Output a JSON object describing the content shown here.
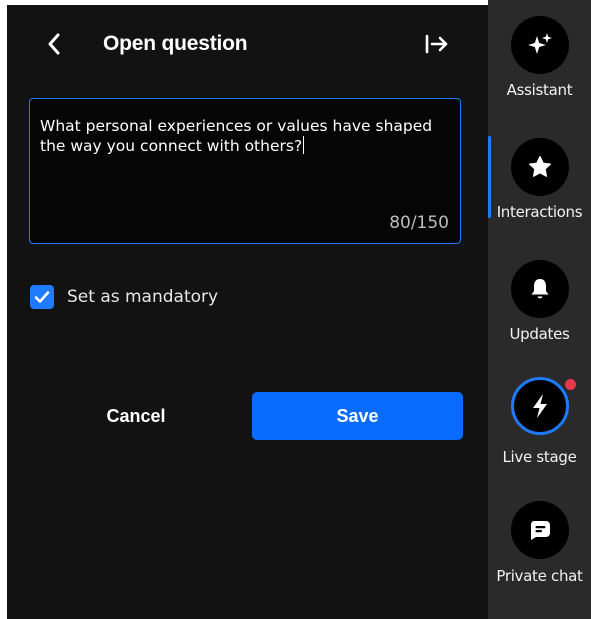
{
  "panel": {
    "title": "Open question",
    "question": {
      "value": "What personal experiences or values have shaped the way you connect with others?",
      "char_count": "80/150"
    },
    "mandatory": {
      "label": "Set as mandatory",
      "checked": true
    },
    "cancel_label": "Cancel",
    "save_label": "Save"
  },
  "sidebar": {
    "items": [
      {
        "label": "Assistant",
        "icon": "sparkles-icon"
      },
      {
        "label": "Interactions",
        "icon": "star-icon",
        "active": true
      },
      {
        "label": "Updates",
        "icon": "bell-icon"
      },
      {
        "label": "Live stage",
        "icon": "lightning-icon",
        "notification": true
      },
      {
        "label": "Private chat",
        "icon": "chat-bubble-icon"
      }
    ]
  },
  "colors": {
    "accent": "#1e7bff",
    "save_button": "#0a6cff",
    "panel_bg": "#121212",
    "sidebar_bg": "#2a2a2a",
    "notification_dot": "#e8394a"
  }
}
